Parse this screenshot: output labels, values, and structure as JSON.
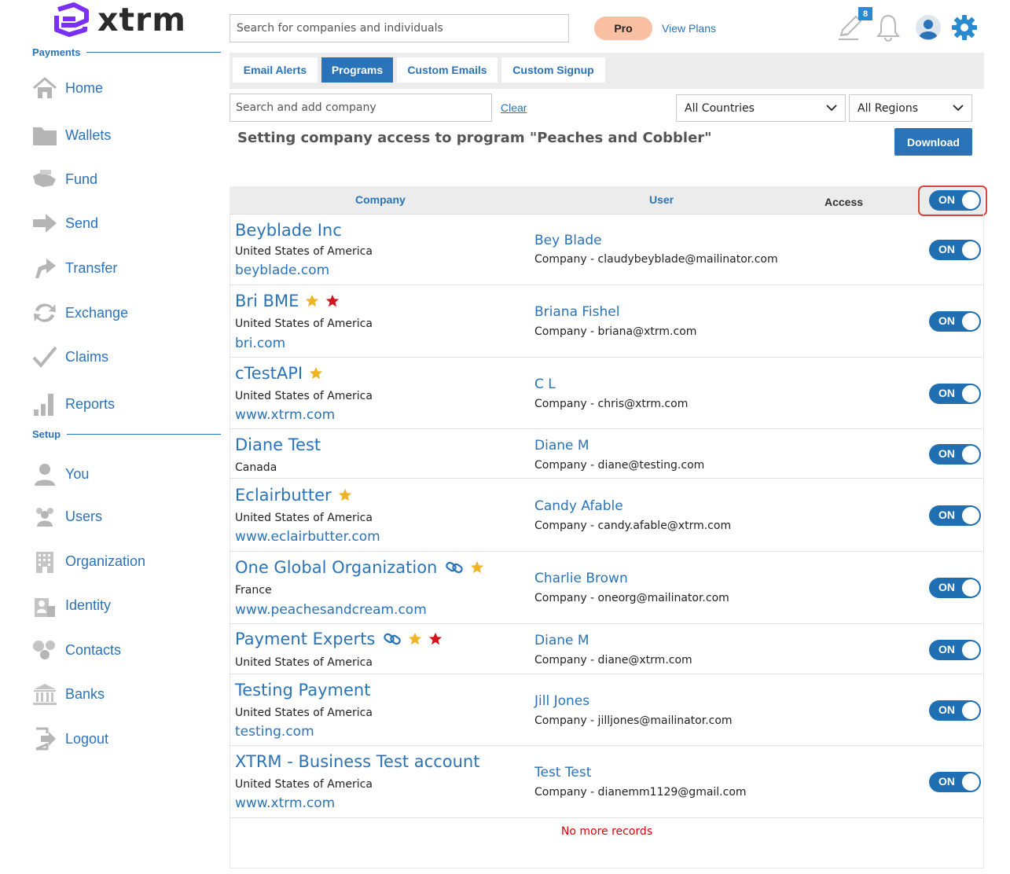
{
  "app": {
    "logo_text": "xtrm"
  },
  "sidebar": {
    "payments_heading": "Payments",
    "setup_heading": "Setup",
    "payments_items": [
      {
        "label": "Home",
        "icon": "home-icon"
      },
      {
        "label": "Wallets",
        "icon": "folder-icon"
      },
      {
        "label": "Fund",
        "icon": "fund-icon"
      },
      {
        "label": "Send",
        "icon": "arrow-right-icon"
      },
      {
        "label": "Transfer",
        "icon": "transfer-icon"
      },
      {
        "label": "Exchange",
        "icon": "exchange-icon"
      },
      {
        "label": "Claims",
        "icon": "checkmark-icon"
      },
      {
        "label": "Reports",
        "icon": "bar-chart-icon"
      }
    ],
    "setup_items": [
      {
        "label": "You",
        "icon": "person-icon"
      },
      {
        "label": "Users",
        "icon": "users-icon"
      },
      {
        "label": "Organization",
        "icon": "building-icon"
      },
      {
        "label": "Identity",
        "icon": "identity-icon"
      },
      {
        "label": "Contacts",
        "icon": "contacts-icon"
      },
      {
        "label": "Banks",
        "icon": "bank-icon"
      },
      {
        "label": "Logout",
        "icon": "logout-icon"
      }
    ]
  },
  "header": {
    "search_placeholder": "Search for companies and individuals",
    "pro_label": "Pro",
    "view_plans": "View Plans",
    "notification_count": "8"
  },
  "tabs": [
    {
      "label": "Email Alerts",
      "active": false
    },
    {
      "label": "Programs",
      "active": true
    },
    {
      "label": "Custom Emails",
      "active": false
    },
    {
      "label": "Custom Signup",
      "active": false
    }
  ],
  "filters": {
    "company_search_placeholder": "Search and add company",
    "clear_label": "Clear",
    "countries_selected": "All Countries",
    "regions_selected": "All Regions"
  },
  "main": {
    "heading": "Setting company access to program \"Peaches and Cobbler\"",
    "download_label": "Download"
  },
  "table": {
    "columns": {
      "company": "Company",
      "user": "User",
      "access": "Access"
    },
    "header_toggle": "ON",
    "rows": [
      {
        "company": "Beyblade Inc",
        "country": "United States of America",
        "website": "beyblade.com",
        "badges": [],
        "user": "Bey Blade",
        "user_detail": "Company - claudybeyblade@mailinator.com",
        "access": "ON"
      },
      {
        "company": "Bri BME",
        "country": "United States of America",
        "website": "bri.com",
        "badges": [
          "gold-star-icon",
          "red-star-icon"
        ],
        "user": "Briana Fishel",
        "user_detail": "Company - briana@xtrm.com",
        "access": "ON"
      },
      {
        "company": "cTestAPI",
        "country": "United States of America",
        "website": "www.xtrm.com",
        "badges": [
          "gold-star-icon"
        ],
        "user": "C L",
        "user_detail": "Company - chris@xtrm.com",
        "access": "ON"
      },
      {
        "company": "Diane Test",
        "country": "Canada",
        "website": "",
        "badges": [],
        "user": "Diane M",
        "user_detail": "Company - diane@testing.com",
        "access": "ON"
      },
      {
        "company": "Eclairbutter",
        "country": "United States of America",
        "website": "www.eclairbutter.com",
        "badges": [
          "gold-star-icon"
        ],
        "user": "Candy Afable",
        "user_detail": "Company - candy.afable@xtrm.com",
        "access": "ON"
      },
      {
        "company": "One Global Organization",
        "country": "France",
        "website": "www.peachesandcream.com",
        "badges": [
          "link-icon",
          "gold-star-icon"
        ],
        "user": "Charlie Brown",
        "user_detail": "Company - oneorg@mailinator.com",
        "access": "ON"
      },
      {
        "company": "Payment Experts",
        "country": "United States of America",
        "website": "",
        "badges": [
          "link-icon",
          "gold-star-icon",
          "red-star-icon"
        ],
        "user": "Diane M",
        "user_detail": "Company - diane@xtrm.com",
        "access": "ON"
      },
      {
        "company": "Testing Payment",
        "country": "United States of America",
        "website": "testing.com",
        "badges": [],
        "user": "Jill Jones",
        "user_detail": "Company - jilljones@mailinator.com",
        "access": "ON"
      },
      {
        "company": "XTRM - Business Test account",
        "country": "United States of America",
        "website": "www.xtrm.com",
        "badges": [],
        "user": "Test Test",
        "user_detail": "Company - dianemm1129@gmail.com",
        "access": "ON"
      }
    ],
    "footer": "No more records"
  },
  "colors": {
    "brand_blue": "#2a73b8",
    "toggle_blue": "#1f6fb2",
    "logo_purple": "#7b2ff2",
    "gold_star": "#f0b323",
    "red_star": "#d4141c",
    "highlight_red": "#d9453d",
    "pro_badge": "#f9bfa3"
  }
}
